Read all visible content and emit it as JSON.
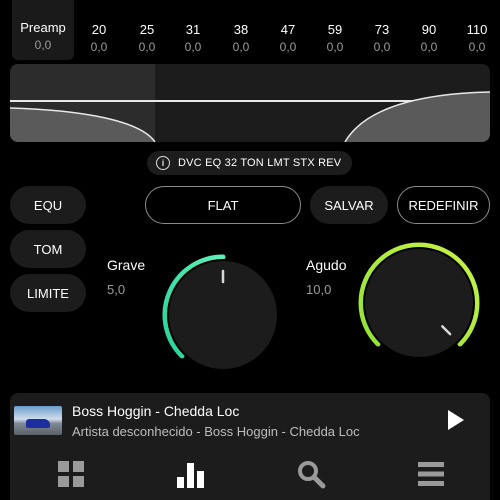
{
  "preamp": {
    "label": "Preamp",
    "value": "0,0"
  },
  "bands": [
    {
      "freq": "20",
      "value": "0,0"
    },
    {
      "freq": "25",
      "value": "0,0"
    },
    {
      "freq": "31",
      "value": "0,0"
    },
    {
      "freq": "38",
      "value": "0,0"
    },
    {
      "freq": "47",
      "value": "0,0"
    },
    {
      "freq": "59",
      "value": "0,0"
    },
    {
      "freq": "73",
      "value": "0,0"
    },
    {
      "freq": "90",
      "value": "0,0"
    },
    {
      "freq": "110",
      "value": "0,0"
    }
  ],
  "info": {
    "text": "DVC EQ 32 TON LMT STX REV",
    "icon": "info-icon"
  },
  "side_tabs": [
    {
      "label": "EQU"
    },
    {
      "label": "TOM"
    },
    {
      "label": "LIMITE"
    }
  ],
  "actions": {
    "flat": "FLAT",
    "save": "SALVAR",
    "reset": "REDEFINIR"
  },
  "knobs": {
    "bass": {
      "label": "Grave",
      "value": "5,0",
      "level": 0.5,
      "color_start": "#26d39a",
      "color_end": "#5ff0b8"
    },
    "treble": {
      "label": "Agudo",
      "value": "10,0",
      "level": 1.0,
      "color_start": "#8fe332",
      "color_end": "#c9f24a"
    }
  },
  "now_playing": {
    "title": "Boss Hoggin - Chedda Loc",
    "artist": "Artista desconhecido - Boss Hoggin - Chedda Loc",
    "play_icon": "play-icon"
  },
  "nav": [
    {
      "icon": "grid-icon"
    },
    {
      "icon": "equalizer-icon",
      "active": true
    },
    {
      "icon": "search-icon"
    },
    {
      "icon": "menu-icon"
    }
  ]
}
